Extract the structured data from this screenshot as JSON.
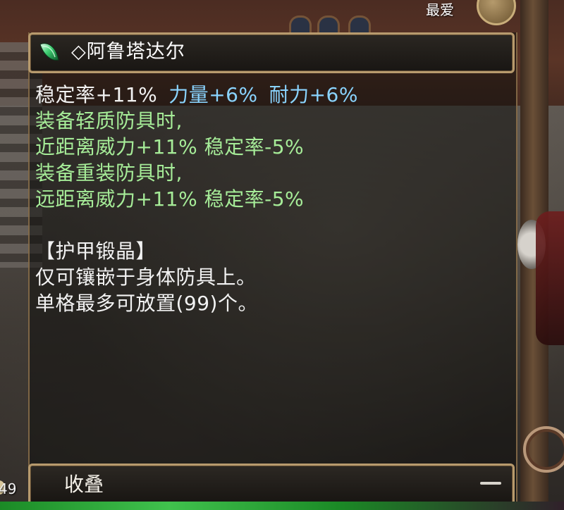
{
  "top": {
    "favorite_label": "最爱"
  },
  "tooltip": {
    "icon": "green-gem-icon",
    "title": "◇阿鲁塔达尔",
    "stats": [
      {
        "text": "稳定率+11%",
        "color": "#f2f2f2"
      },
      {
        "text": "力量+6%",
        "color": "#8ad4ff"
      },
      {
        "text": "耐力+6%",
        "color": "#8ad4ff"
      }
    ],
    "bonus_lines": [
      "装备轻质防具时,",
      "近距离威力+11% 稳定率-5%",
      "装备重装防具时,",
      "远距离威力+11% 稳定率-5%"
    ],
    "category": "【护甲锻晶】",
    "desc_lines": [
      "仅可镶嵌于身体防具上。",
      "单格最多可放置(99)个。"
    ],
    "footer_label": "收叠"
  },
  "hud": {
    "left_number": "49"
  },
  "colors": {
    "frame": "#b79a6d",
    "stat_white": "#f2f2f2",
    "stat_cyan": "#8ad4ff",
    "bonus_green": "#a6ec98"
  }
}
